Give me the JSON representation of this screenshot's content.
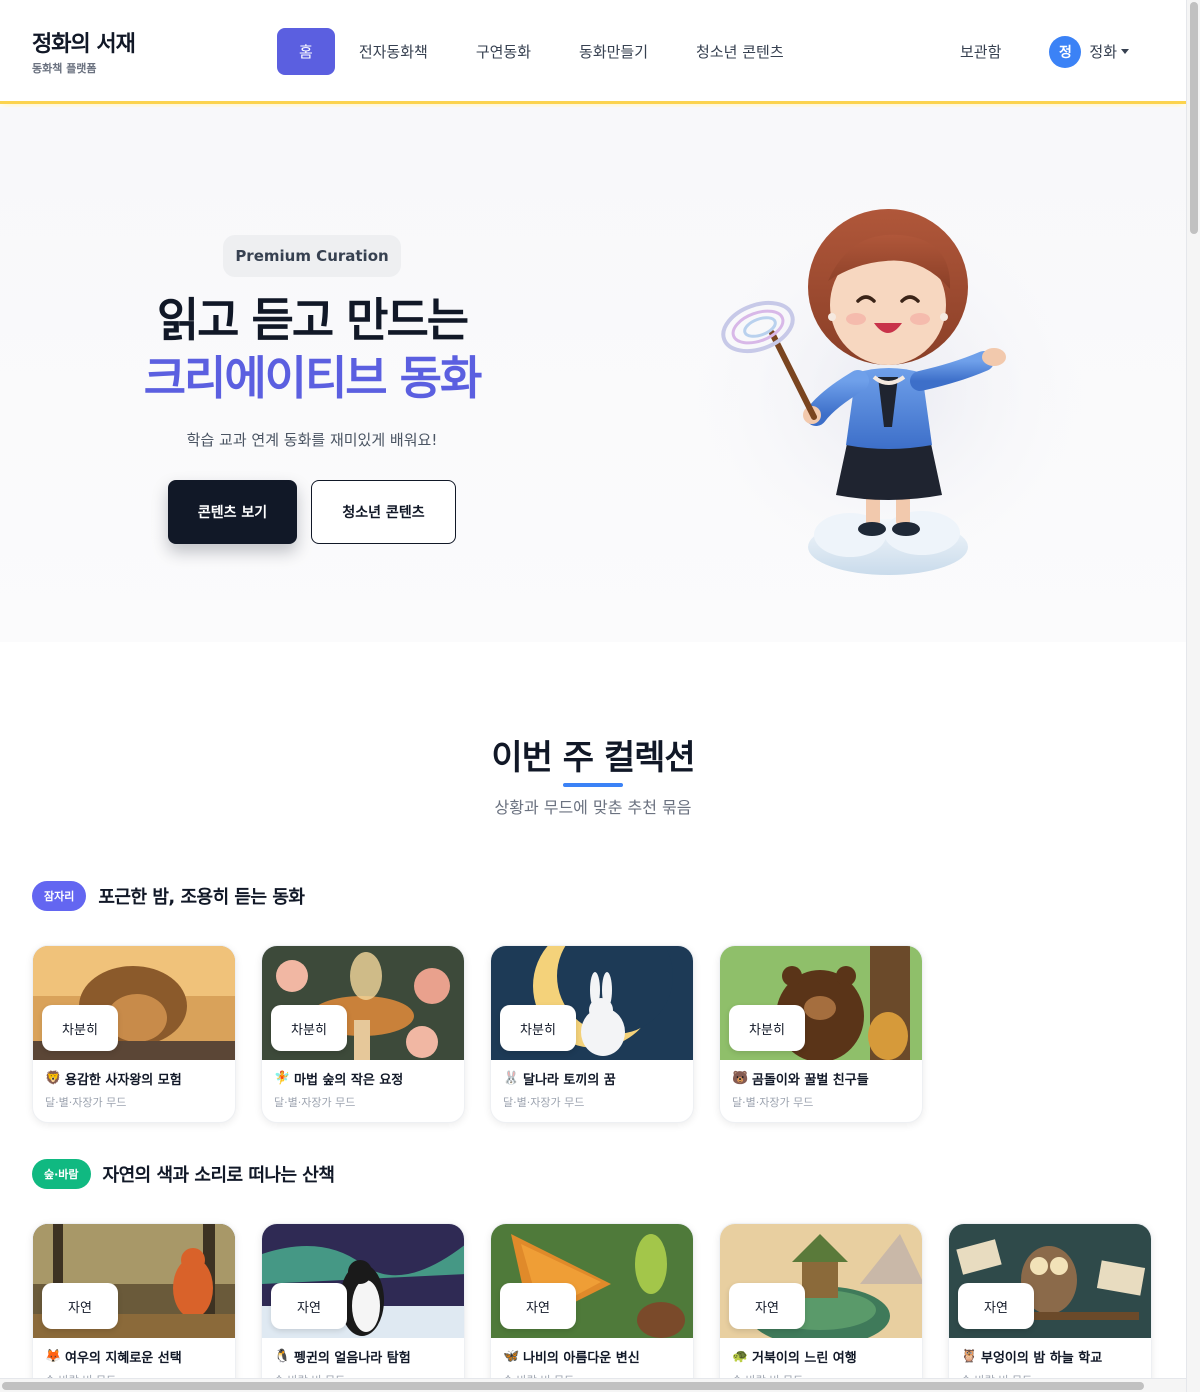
{
  "header": {
    "brand_title": "정화의 서재",
    "brand_sub": "동화책 플랫폼",
    "nav": [
      "홈",
      "전자동화책",
      "구연동화",
      "동화만들기",
      "청소년 콘텐츠"
    ],
    "locker": "보관함",
    "user_initial": "정",
    "user_name": "정화"
  },
  "hero": {
    "pill": "Premium Curation",
    "title_line1": "읽고 듣고 만드는",
    "title_line2": "크리에이티브 동화",
    "desc": "학습 교과 연계 동화를 재미있게 배워요!",
    "btn_primary": "콘텐츠 보기",
    "btn_secondary": "청소년 콘텐츠"
  },
  "collections": {
    "title": "이번 주 컬렉션",
    "subtitle": "상황과 무드에 맞춘 추천 묶음",
    "groups": [
      {
        "tag": "잠자리",
        "tag_color": "#6366f1",
        "title": "포근한 밤, 조용히 듣는 동화",
        "cards": [
          {
            "mood": "차분히",
            "emoji": "🦁",
            "title": "용감한 사자왕의 모험",
            "sub": "달·별·자장가 무드"
          },
          {
            "mood": "차분히",
            "emoji": "🧚",
            "title": "마법 숲의 작은 요정",
            "sub": "달·별·자장가 무드"
          },
          {
            "mood": "차분히",
            "emoji": "🐰",
            "title": "달나라 토끼의 꿈",
            "sub": "달·별·자장가 무드"
          },
          {
            "mood": "차분히",
            "emoji": "🐻",
            "title": "곰돌이와 꿀벌 친구들",
            "sub": "달·별·자장가 무드"
          }
        ]
      },
      {
        "tag": "숲·바람",
        "tag_color": "#10b981",
        "title": "자연의 색과 소리로 떠나는 산책",
        "cards": [
          {
            "mood": "자연",
            "emoji": "🦊",
            "title": "여우의 지혜로운 선택",
            "sub": "숲·바람·비 무드"
          },
          {
            "mood": "자연",
            "emoji": "🐧",
            "title": "펭귄의 얼음나라 탐험",
            "sub": "숲·바람·비 무드"
          },
          {
            "mood": "자연",
            "emoji": "🦋",
            "title": "나비의 아름다운 변신",
            "sub": "숲·바람·비 무드"
          },
          {
            "mood": "자연",
            "emoji": "🐢",
            "title": "거북이의 느린 여행",
            "sub": "숲·바람·비 무드"
          },
          {
            "mood": "자연",
            "emoji": "🦉",
            "title": "부엉이의 밤 하늘 학교",
            "sub": "숲·바람·비 무드"
          }
        ]
      }
    ]
  }
}
